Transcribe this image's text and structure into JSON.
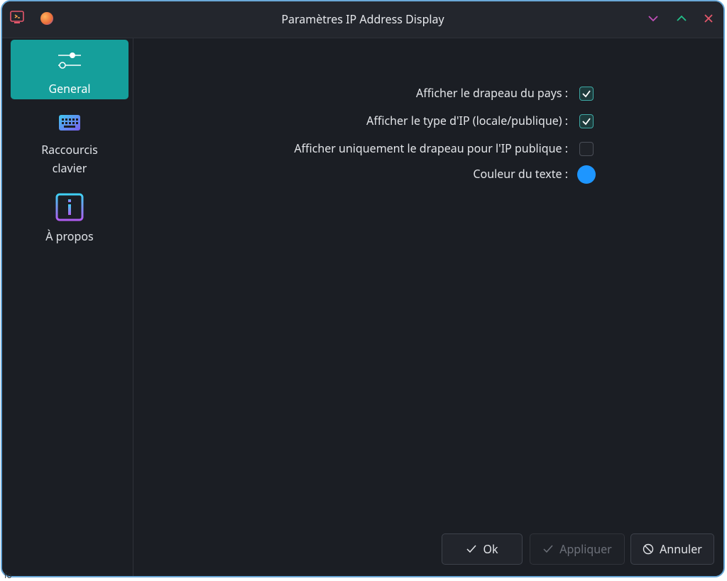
{
  "window": {
    "title": "Paramètres IP Address Display"
  },
  "sidebar": {
    "items": [
      {
        "label": "General",
        "icon": "sliders-icon",
        "active": true
      },
      {
        "label": "Raccourcis clavier",
        "line1": "Raccourcis",
        "line2": "clavier",
        "icon": "keyboard-icon",
        "active": false
      },
      {
        "label": "À propos",
        "icon": "info-icon",
        "active": false
      }
    ]
  },
  "settings": {
    "show_flag": {
      "label": "Afficher le drapeau du pays :",
      "checked": true
    },
    "show_ip_type": {
      "label": "Afficher le type d'IP (locale/publique) :",
      "checked": true
    },
    "flag_only_public": {
      "label": "Afficher uniquement le drapeau pour l'IP publique :",
      "checked": false
    },
    "text_color": {
      "label": "Couleur du texte :",
      "value": "#1e96ff"
    }
  },
  "buttons": {
    "ok": "Ok",
    "apply": "Appliquer",
    "cancel": "Annuler"
  },
  "colors": {
    "accent": "#159f9b",
    "minimize": "#c14fb8",
    "maximize": "#22c08a",
    "close": "#e4576b"
  },
  "overflow_text": "fo"
}
